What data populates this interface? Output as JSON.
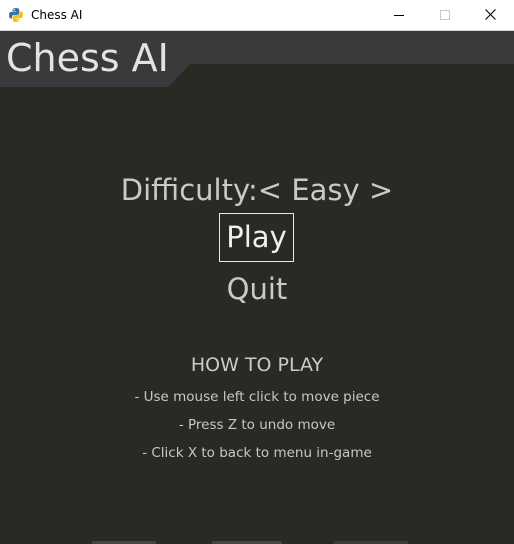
{
  "window": {
    "title": "Chess AI",
    "app_icon": "python-icon",
    "controls": {
      "minimize": "minimize-icon",
      "maximize": "maximize-icon",
      "close": "close-icon"
    }
  },
  "header": {
    "title": "Chess AI"
  },
  "menu": {
    "difficulty_label": "Difficulty:< Easy >",
    "play_label": "Play",
    "quit_label": "Quit"
  },
  "how_to_play": {
    "heading": "HOW TO PLAY",
    "lines": [
      "- Use mouse left click to move piece",
      "- Press Z to undo move",
      "- Click X to back to menu in-game"
    ]
  },
  "colors": {
    "background": "#2a2a25",
    "header_panel": "#3a3a3c",
    "header_band": "#25252a",
    "text": "#c9c9c9",
    "selected_border": "#e8e8e8"
  }
}
